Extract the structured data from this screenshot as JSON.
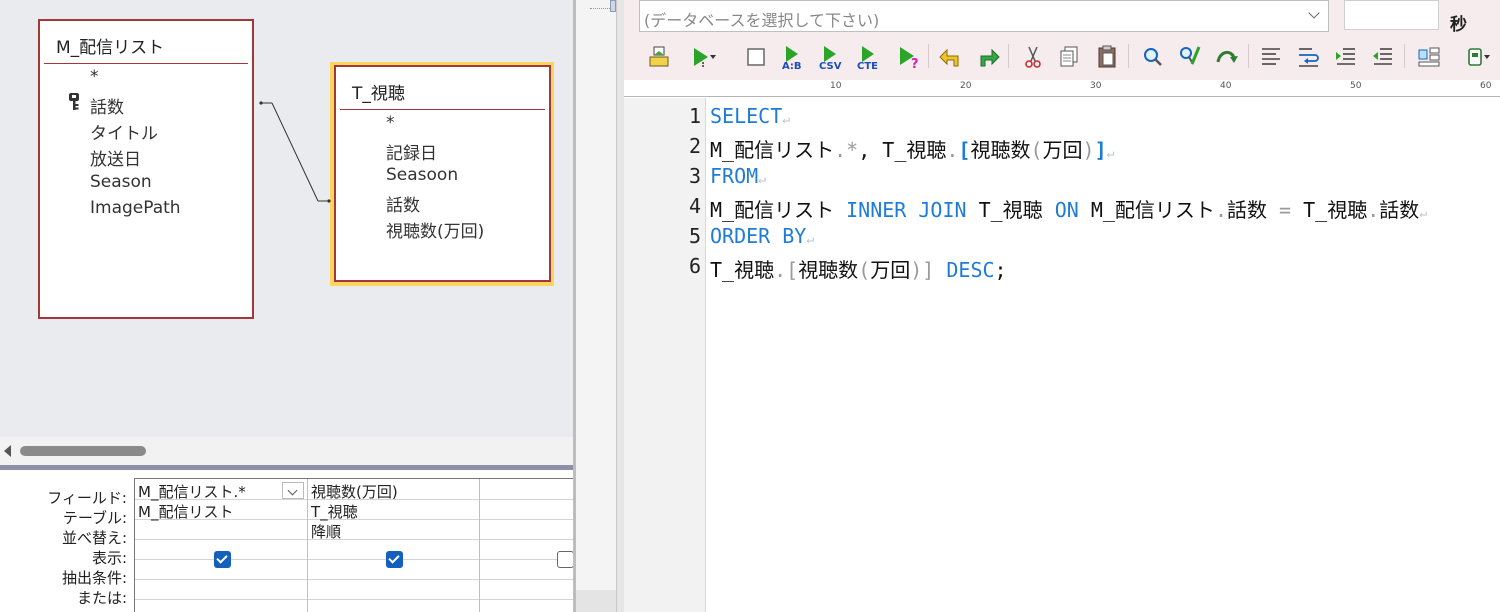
{
  "design": {
    "tables": [
      {
        "title": "M_配信リスト",
        "fields": [
          "*",
          "話数",
          "タイトル",
          "放送日",
          "Season",
          "ImagePath"
        ],
        "key_field": "話数"
      },
      {
        "title": "T_視聴",
        "fields": [
          "*",
          "記録日",
          "Seasoon",
          "話数",
          "視聴数(万回)"
        ],
        "selected": true
      }
    ],
    "join": "M_配信リスト.話数 = T_視聴.話数"
  },
  "grid": {
    "row_labels": [
      "フィールド:",
      "テーブル:",
      "並べ替え:",
      "表示:",
      "抽出条件:",
      "または:"
    ],
    "columns": [
      {
        "field": "M_配信リスト.*",
        "table": "M_配信リスト",
        "sort": "",
        "show": true
      },
      {
        "field": "視聴数(万回)",
        "table": "T_視聴",
        "sort": "降順",
        "show": true
      }
    ]
  },
  "editor": {
    "db_placeholder": "(データベースを選択して下さい)",
    "seconds_label": "秒",
    "toolbar_icons": [
      "open-db-icon",
      "run-icon",
      "stop-icon",
      "export-ab-icon",
      "export-csv-icon",
      "export-cte-icon",
      "run-help-icon",
      "undo-icon",
      "redo-icon",
      "cut-icon",
      "copy-icon",
      "paste-icon",
      "search-icon",
      "replace-icon",
      "jump-icon",
      "align-icon",
      "wrap-icon",
      "indent-icon",
      "outdent-icon",
      "layout-icon",
      "plugin-icon"
    ],
    "ruler_marks": [
      "10",
      "20",
      "30",
      "40",
      "50",
      "60"
    ],
    "line_numbers": [
      "1",
      "2",
      "3",
      "4",
      "5",
      "6"
    ],
    "code": {
      "l1_kw": "SELECT",
      "l2_a": "M_配信リスト",
      "l2_b": ".*",
      "l2_c": ", ",
      "l2_d": "T_視聴",
      "l2_e": ".",
      "l2_f": "[",
      "l2_g": "視聴数",
      "l2_h": "(",
      "l2_i": "万回",
      "l2_j": ")",
      "l2_k": "]",
      "l3_kw": "FROM",
      "l4_a": "M_配信リスト ",
      "l4_kw1": "INNER JOIN",
      "l4_b": " T_視聴 ",
      "l4_kw2": "ON",
      "l4_c": " M_配信リスト",
      "l4_d": ".",
      "l4_e": "話数 ",
      "l4_f": "=",
      "l4_g": " T_視聴",
      "l4_h": ".",
      "l4_i": "話数",
      "l5_kw": "ORDER BY",
      "l6_a": "T_視聴",
      "l6_b": ".[",
      "l6_c": "視聴数",
      "l6_d": "(",
      "l6_e": "万回",
      "l6_f": ")]",
      "l6_kw": " DESC",
      "l6_g": ";",
      "newline_mark": "↵"
    }
  },
  "colors": {
    "table_border": "#a4373a",
    "selected_table_highlight": "#fbd55d",
    "keyword": "#1f7cd6",
    "toolbar_bg": "#f6ecee",
    "checkbox": "#1560bd"
  }
}
